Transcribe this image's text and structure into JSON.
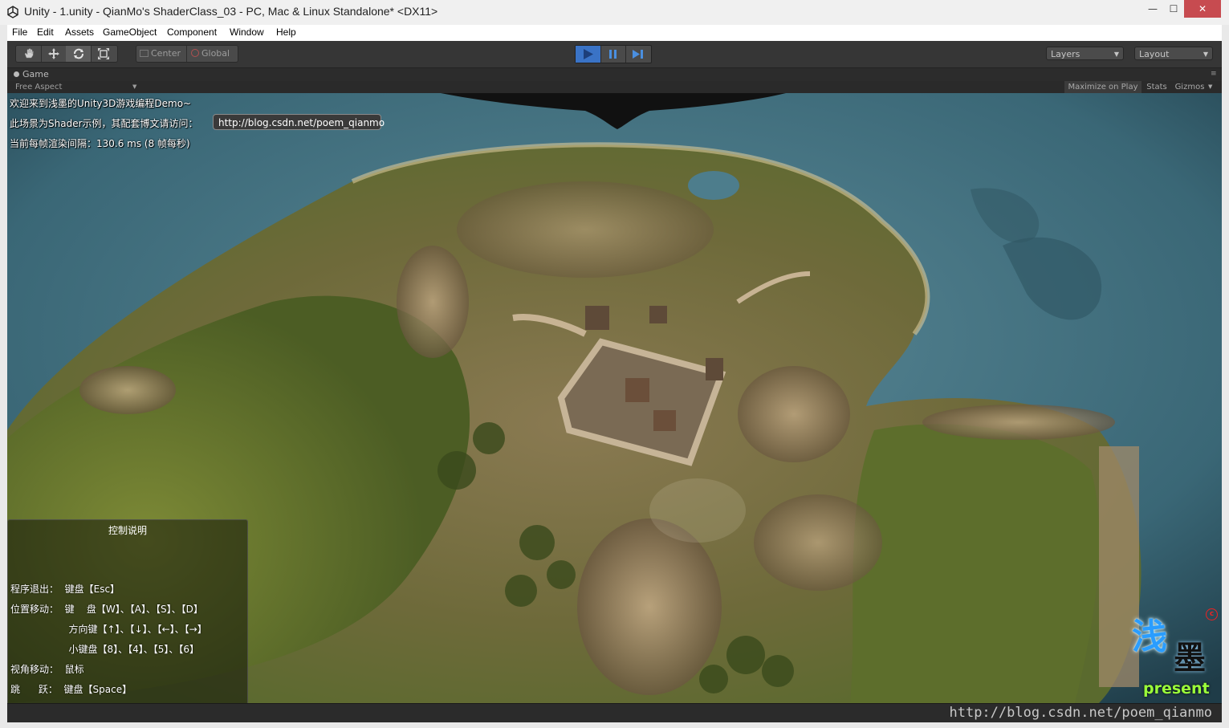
{
  "window": {
    "title": "Unity - 1.unity - QianMo's ShaderClass_03 - PC, Mac & Linux Standalone* <DX11>",
    "controls": {
      "minimize": "—",
      "maximize": "☐",
      "close": "✕"
    }
  },
  "menu": [
    "File",
    "Edit",
    "Assets",
    "GameObject",
    "Component",
    "Window",
    "Help"
  ],
  "toolbar": {
    "pivot_center": "Center",
    "pivot_global": "Global",
    "layers": "Layers",
    "layout": "Layout",
    "colors": {
      "play_active": "#3a73c6",
      "play_icon": "#4aa0ff"
    }
  },
  "game_tab": {
    "label": "Game",
    "aspect": "Free Aspect",
    "maximize_on_play": "Maximize on Play",
    "stats": "Stats",
    "gizmos": "Gizmos"
  },
  "hud": {
    "welcome": "欢迎来到浅墨的Unity3D游戏编程Demo~",
    "shader_info": "此场景为Shader示例，其配套博文请访问：",
    "link": "http://blog.csdn.net/poem_qianmo",
    "frame_time": "当前每帧渲染间隔：130.6 ms (8 帧每秒)"
  },
  "controls_panel": {
    "title": "控制说明",
    "lines": [
      "程序退出：  键盘【Esc】",
      "位置移动：  键    盘【W】、【A】、【S】、【D】",
      "                   方向键【↑】、【↓】、【←】、【→】",
      "                   小键盘【8】、【4】、【5】、【6】",
      "视角移动：  鼠标",
      "跳      跃：  键盘【Space】"
    ]
  },
  "logo": {
    "text_top": "浅",
    "text_mid": "墨",
    "text_bottom": "present",
    "mark": "c"
  },
  "watermark": "http://blog.csdn.net/poem_qianmo"
}
